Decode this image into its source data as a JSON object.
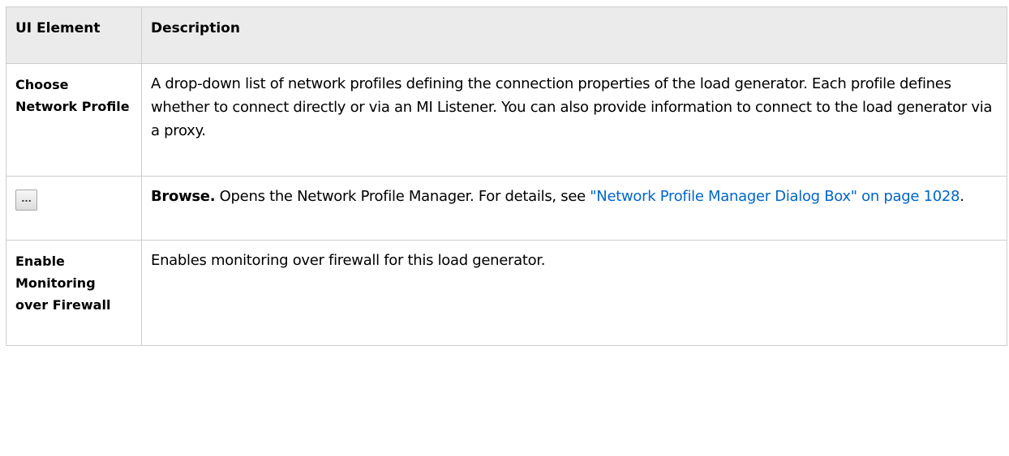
{
  "table": {
    "headers": {
      "col1": "UI Element",
      "col2": "Description"
    },
    "rows": [
      {
        "element": "Choose Network Profile",
        "description": "A drop-down list of network profiles defining the connection properties of the load generator. Each profile defines whether to connect directly or via an MI Listener. You can also provide information to connect to the load generator via a proxy."
      },
      {
        "element_button_label": "...",
        "element_icon": "ellipsis-browse-button",
        "description_bold": "Browse.",
        "description_text": " Opens the Network Profile Manager. For details, see ",
        "description_link": "\"Network Profile Manager Dialog Box\" on page 1028",
        "description_end": "."
      },
      {
        "element": "Enable Monitoring over Firewall",
        "description": "Enables monitoring over firewall for this load generator."
      }
    ]
  },
  "colors": {
    "header_background": "#ebebeb",
    "border": "#cdcdcd",
    "link": "#0066cc"
  }
}
